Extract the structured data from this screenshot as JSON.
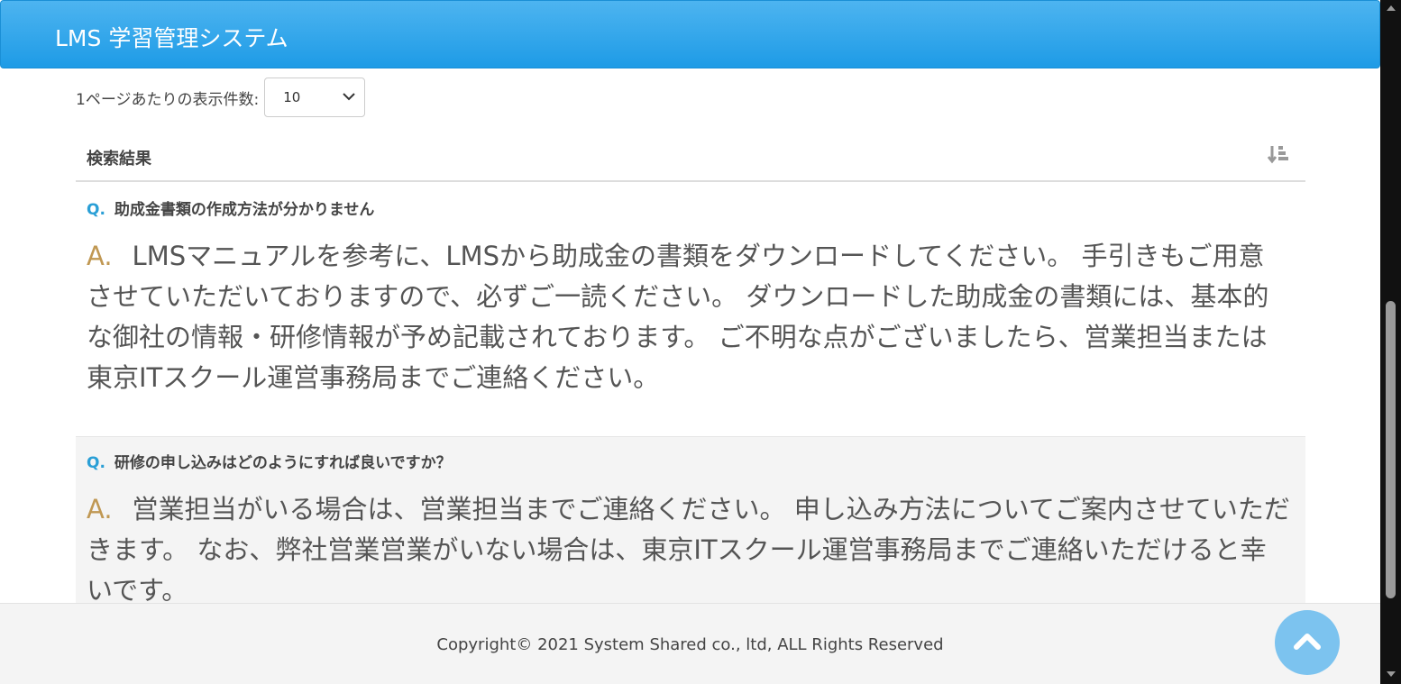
{
  "app": {
    "title": "LMS 学習管理システム"
  },
  "pagination": {
    "label": "1ページあたりの表示件数:",
    "selected": "10"
  },
  "results": {
    "heading": "検索結果",
    "items": [
      {
        "q_marker": "Q.",
        "question": "助成金書類の作成方法が分かりません",
        "a_marker": "A.",
        "answer": "LMSマニュアルを参考に、LMSから助成金の書類をダウンロードしてください。 手引きもご用意させていただいておりますので、必ずご一読ください。 ダウンロードした助成金の書類には、基本的な御社の情報・研修情報が予め記載されております。 ご不明な点がございましたら、営業担当または東京ITスクール運営事務局までご連絡ください。"
      },
      {
        "q_marker": "Q.",
        "question": "研修の申し込みはどのようにすれば良いですか？",
        "a_marker": "A.",
        "answer": "営業担当がいる場合は、営業担当までご連絡ください。 申し込み方法についてご案内させていただきます。 なお、弊社営業営業がいない場合は、東京ITスクール運営事務局までご連絡いただけると幸いです。"
      }
    ]
  },
  "footer": {
    "copyright": "Copyright© 2021 System Shared co., ltd, ALL Rights Reserved"
  },
  "icons": {
    "sort": "sort-amount-icon",
    "back_to_top": "chevron-up-icon"
  },
  "colors": {
    "navbar": "#2aa3ea",
    "question_marker": "#2a9fd6",
    "answer_marker": "#c09853",
    "back_to_top": "#7cc3ef"
  }
}
